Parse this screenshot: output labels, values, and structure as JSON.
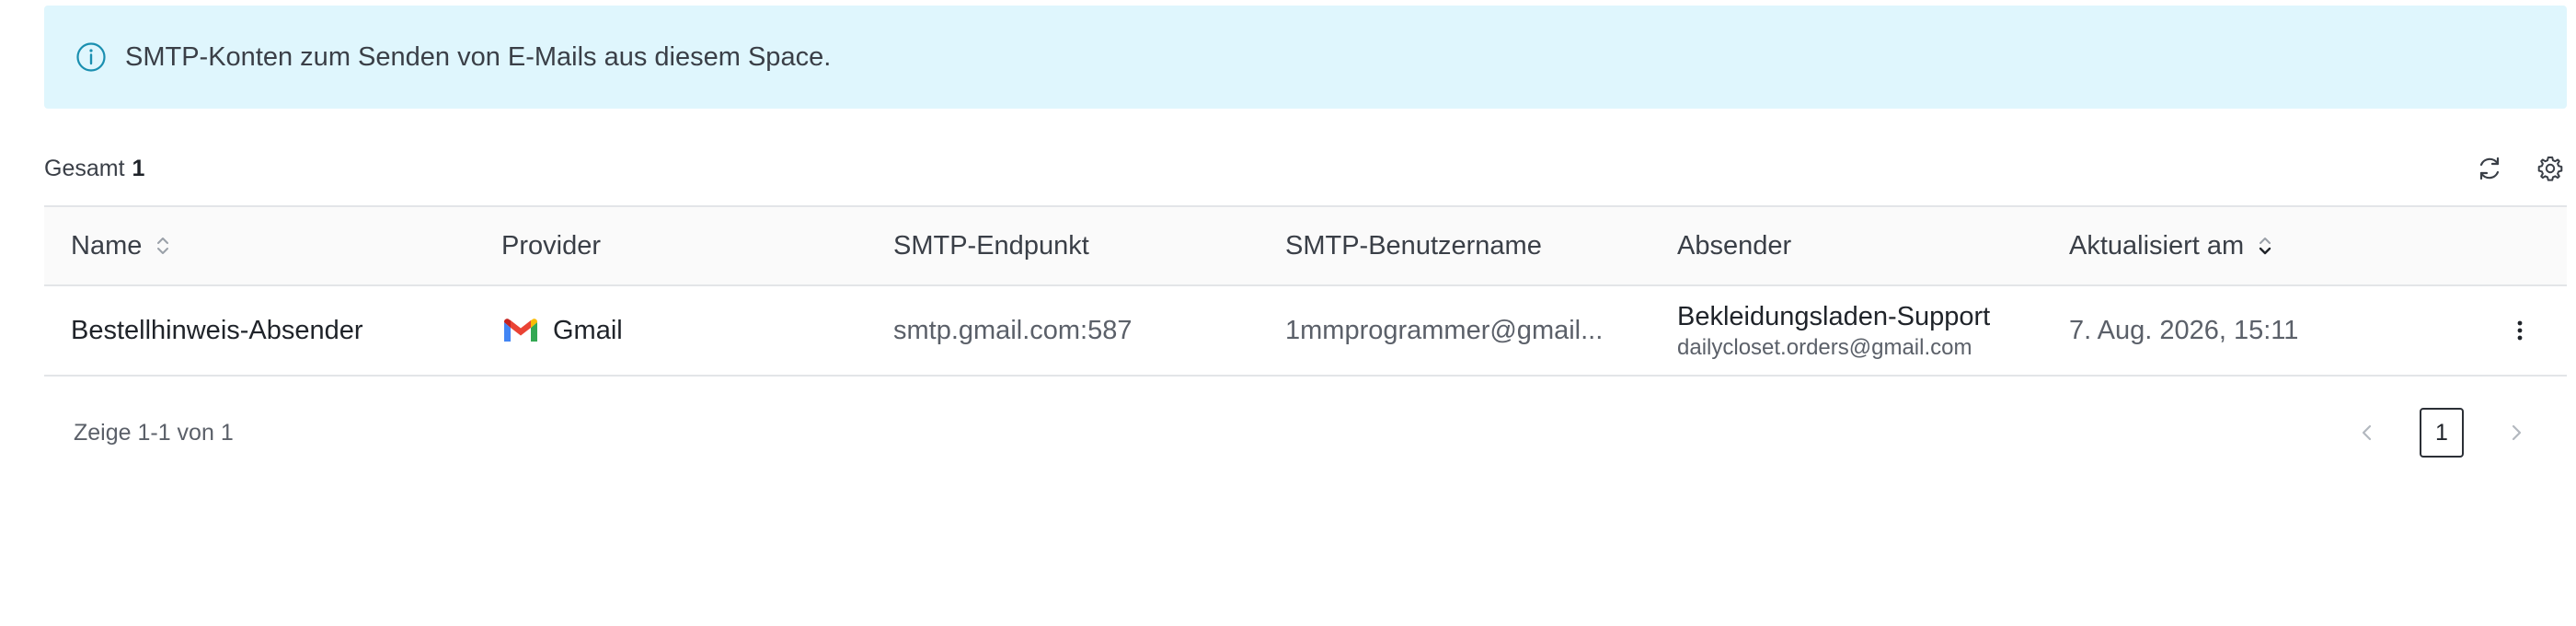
{
  "banner": {
    "icon": "info-icon",
    "text": "SMTP-Konten zum Senden von E-Mails aus diesem Space."
  },
  "summary": {
    "total_label": "Gesamt",
    "total_count": "1"
  },
  "toolbar": {
    "refresh_icon": "refresh-icon",
    "settings_icon": "gear-icon"
  },
  "table": {
    "columns": [
      {
        "label": "Name",
        "sortable": true
      },
      {
        "label": "Provider"
      },
      {
        "label": "SMTP-Endpunkt"
      },
      {
        "label": "SMTP-Benutzername"
      },
      {
        "label": "Absender"
      },
      {
        "label": "Aktualisiert am",
        "sortable": true,
        "sorted": "desc"
      }
    ],
    "rows": [
      {
        "name": "Bestellhinweis-Absender",
        "provider": "Gmail",
        "provider_icon": "gmail-logo-icon",
        "endpoint": "smtp.gmail.com:587",
        "username": "1mmprogrammer@gmail...",
        "sender_name": "Bekleidungsladen-Support",
        "sender_email": "dailycloset.orders@gmail.com",
        "updated": "7. Aug. 2026, 15:11"
      }
    ]
  },
  "pagination": {
    "range_text": "Zeige 1-1 von 1",
    "current_page": "1"
  },
  "colors": {
    "banner_bg": "#dff6fd",
    "banner_icon": "#1a8fb0"
  }
}
